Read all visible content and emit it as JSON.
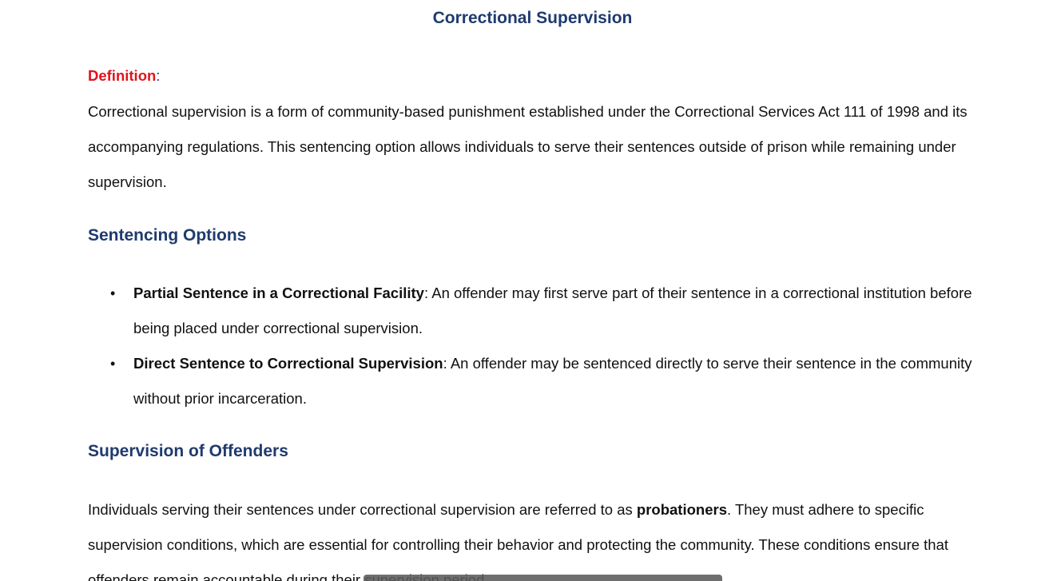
{
  "document": {
    "title": "Correctional Supervision",
    "definition": {
      "label": "Definition",
      "colon": ":",
      "text": "Correctional supervision is a form of community-based punishment established under the Correctional Services Act 111 of 1998 and its accompanying regulations. This sentencing option allows individuals to serve their sentences outside of prison while remaining under supervision."
    },
    "sentencing_options": {
      "heading": "Sentencing Options",
      "items": [
        {
          "term": "Partial Sentence in a Correctional Facility",
          "text": ": An offender may first serve part of their sentence in a correctional institution before being placed under correctional supervision."
        },
        {
          "term": "Direct Sentence to Correctional Supervision",
          "text": ": An offender may be sentenced directly to serve their sentence in the community without prior incarceration."
        }
      ]
    },
    "supervision_of_offenders": {
      "heading": "Supervision of Offenders",
      "text_before": "Individuals serving their sentences under correctional supervision are referred to as ",
      "bold_term": "probationers",
      "text_after": ". They must adhere to specific supervision conditions, which are essential for controlling their behavior and protecting the community. These conditions ensure that offenders remain accountable during their supervision period."
    }
  },
  "bullet_glyph": "•",
  "colors": {
    "heading": "#1f3b6e",
    "definition_label": "#e0141e",
    "body_text": "#111111"
  }
}
